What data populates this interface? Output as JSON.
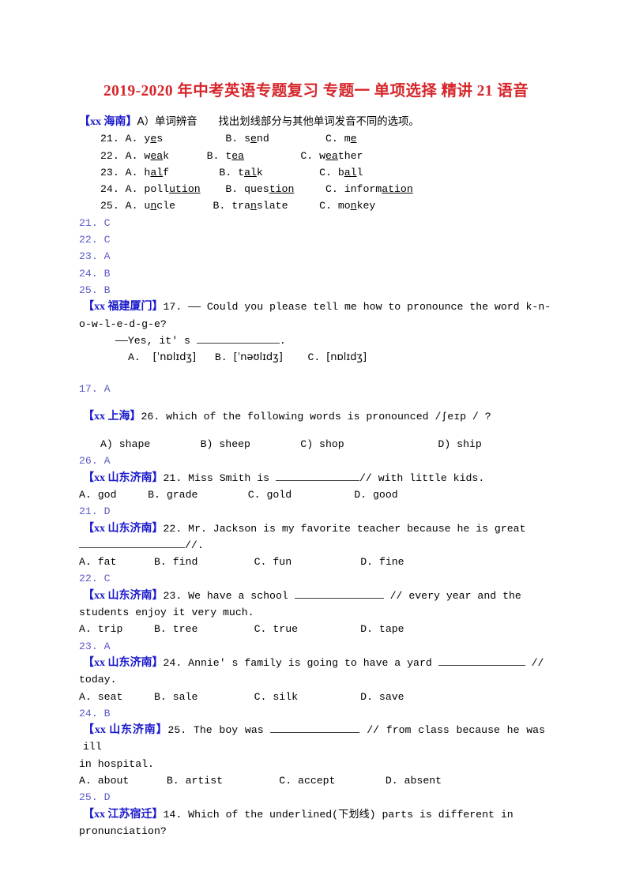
{
  "document": {
    "title": "2019-2020 年中考英语专题复习 专题一 单项选择 精讲 21 语音",
    "title_color": "#d6262b",
    "tag_color": "#1a19cb",
    "answer_color": "#5b5bc9"
  },
  "sections": {
    "hainan": {
      "tag": "【xx 海南】",
      "prompt": "A）单词辨音　　找出划线部分与其他单词发音不同的选项。",
      "items": [
        {
          "num": "21.",
          "options": [
            {
              "letter": "A.",
              "pre": "y",
              "mark": "e",
              "post": "s"
            },
            {
              "letter": "B.",
              "pre": "s",
              "mark": "e",
              "post": "nd"
            },
            {
              "letter": "C.",
              "pre": "m",
              "mark": "e",
              "post": ""
            }
          ]
        },
        {
          "num": "22.",
          "options": [
            {
              "letter": "A.",
              "pre": "w",
              "mark": "ea",
              "post": "k"
            },
            {
              "letter": "B.",
              "pre": "t",
              "mark": "ea",
              "post": ""
            },
            {
              "letter": "C.",
              "pre": "w",
              "mark": "ea",
              "post": "ther"
            }
          ]
        },
        {
          "num": "23.",
          "options": [
            {
              "letter": "A.",
              "pre": "h",
              "mark": "al",
              "post": "f"
            },
            {
              "letter": "B.",
              "pre": "t",
              "mark": "al",
              "post": "k"
            },
            {
              "letter": "C.",
              "pre": "b",
              "mark": "al",
              "post": "l"
            }
          ]
        },
        {
          "num": "24.",
          "options": [
            {
              "letter": "A.",
              "pre": "poll",
              "mark": "ution",
              "post": ""
            },
            {
              "letter": "B.",
              "pre": "ques",
              "mark": "tion",
              "post": ""
            },
            {
              "letter": "C.",
              "pre": "inform",
              "mark": "ation",
              "post": ""
            }
          ]
        },
        {
          "num": "25.",
          "options": [
            {
              "letter": "A.",
              "pre": "u",
              "mark": "n",
              "post": "cle"
            },
            {
              "letter": "B.",
              "pre": "tra",
              "mark": "n",
              "post": "slate"
            },
            {
              "letter": "C.",
              "pre": "mo",
              "mark": "n",
              "post": "key"
            }
          ]
        }
      ],
      "answers": [
        "21. C",
        "22. C",
        "23. A",
        "24. B",
        "25. B"
      ]
    },
    "fujian_xiamen": {
      "tag": "【xx 福建厦门】",
      "question_line1": "17. —— Could you please tell me how to pronounce the word k-n-",
      "question_line2": "o-w-l-e-d-g-e?",
      "question_line3_pre": "——Yes, it' s ",
      "question_line3_post": ".",
      "options": [
        {
          "letter": "A.",
          "text": "[ˈnɒlɪdʒ]"
        },
        {
          "letter": "B.",
          "text": "[ˈnəʊlɪdʒ]"
        },
        {
          "letter": "C.",
          "text": "[nɒlɪdʒ]"
        }
      ],
      "answer": "17. A"
    },
    "shanghai": {
      "tag": "【xx 上海】",
      "question": "26. which of the following words is pronounced /ʃeɪp / ?",
      "options": [
        {
          "letter": "A)",
          "text": "shape"
        },
        {
          "letter": "B)",
          "text": "sheep"
        },
        {
          "letter": "C)",
          "text": "shop"
        },
        {
          "letter": "D)",
          "text": "ship"
        }
      ],
      "answer": "26. A"
    },
    "jinan_21": {
      "tag": "【xx 山东济南】",
      "stem_pre": "21. Miss Smith is ",
      "stem_post": "// with little kids.",
      "options": [
        {
          "letter": "A.",
          "text": "god"
        },
        {
          "letter": "B.",
          "text": "grade"
        },
        {
          "letter": "C.",
          "text": "gold"
        },
        {
          "letter": "D.",
          "text": "good"
        }
      ],
      "answer": "21. D"
    },
    "jinan_22": {
      "tag": "【xx 山东济南】",
      "stem_line1": "22. Mr. Jackson is my favorite teacher because he is great",
      "stem_line2_post": "//.",
      "options": [
        {
          "letter": "A.",
          "text": "fat"
        },
        {
          "letter": "B.",
          "text": "find"
        },
        {
          "letter": "C.",
          "text": "fun"
        },
        {
          "letter": "D.",
          "text": "fine"
        }
      ],
      "answer": "22. C"
    },
    "jinan_23": {
      "tag": "【xx 山东济南】",
      "stem_line1_pre": "23. We have a school ",
      "stem_line1_post": " // every year and the",
      "stem_line2": "students enjoy it very much.",
      "options": [
        {
          "letter": "A.",
          "text": "trip"
        },
        {
          "letter": "B.",
          "text": "tree"
        },
        {
          "letter": "C.",
          "text": "true"
        },
        {
          "letter": "D.",
          "text": "tape"
        }
      ],
      "answer": "23. A"
    },
    "jinan_24": {
      "tag": "【xx 山东济南】",
      "stem_line1_pre": "24. Annie' s family is going to have a yard ",
      "stem_line1_post": " //",
      "stem_line2": "today.",
      "options": [
        {
          "letter": "A.",
          "text": "seat"
        },
        {
          "letter": "B.",
          "text": "sale"
        },
        {
          "letter": "C.",
          "text": "silk"
        },
        {
          "letter": "D.",
          "text": "save"
        }
      ],
      "answer": "24. B"
    },
    "jinan_25": {
      "tag": "【xx 山东济南】",
      "stem_line1_pre": "25. The boy was ",
      "stem_line1_post": " // from class because he was ill",
      "stem_line2": "in hospital.",
      "options": [
        {
          "letter": "A.",
          "text": "about"
        },
        {
          "letter": "B.",
          "text": "artist"
        },
        {
          "letter": "C.",
          "text": "accept"
        },
        {
          "letter": "D.",
          "text": "absent"
        }
      ],
      "answer": "25. D"
    },
    "jiangsu_suqian": {
      "tag": "【xx 江苏宿迁】",
      "stem_line1": "14. Which of the underlined(下划线) parts is different in",
      "stem_line2": "pronunciation?"
    }
  }
}
